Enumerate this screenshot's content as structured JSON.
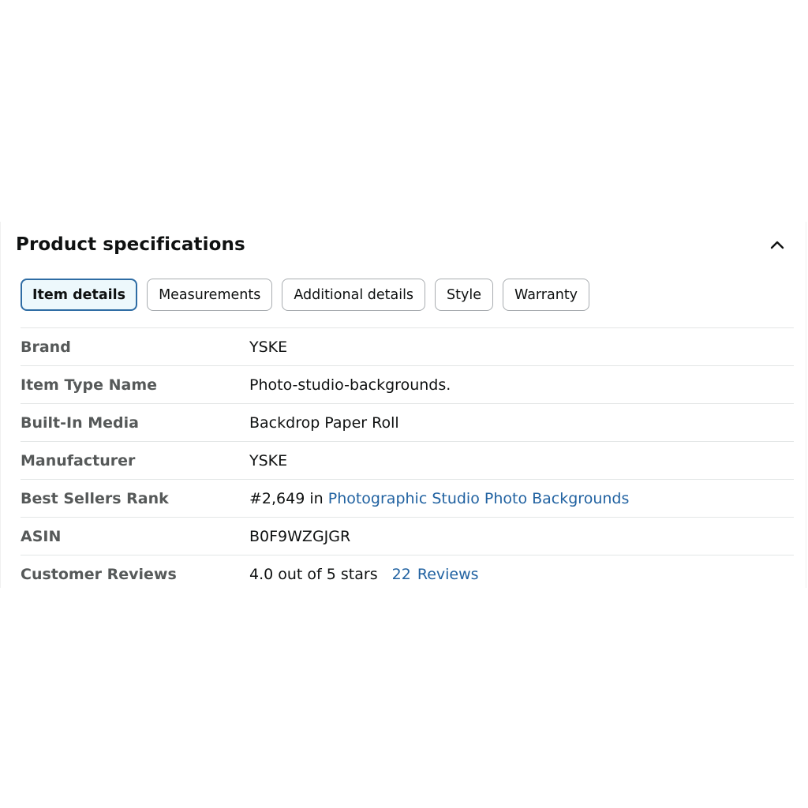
{
  "section": {
    "title": "Product specifications",
    "collapse_icon": "chevron-up-icon"
  },
  "tabs": [
    {
      "label": "Item details",
      "active": true
    },
    {
      "label": "Measurements",
      "active": false
    },
    {
      "label": "Additional details",
      "active": false
    },
    {
      "label": "Style",
      "active": false
    },
    {
      "label": "Warranty",
      "active": false
    }
  ],
  "specs": {
    "brand": {
      "label": "Brand",
      "value": "YSKE"
    },
    "item_type": {
      "label": "Item Type Name",
      "value": "Photo-studio-backgrounds."
    },
    "built_in_media": {
      "label": "Built-In Media",
      "value": "Backdrop Paper Roll"
    },
    "manufacturer": {
      "label": "Manufacturer",
      "value": "YSKE"
    },
    "rank": {
      "label": "Best Sellers Rank",
      "prefix": "#2,649 in",
      "category_link": "Photographic Studio Photo Backgrounds"
    },
    "asin": {
      "label": "ASIN",
      "value": "B0F9WZGJGR"
    },
    "reviews": {
      "label": "Customer Reviews",
      "rating_text": "4.0 out of 5 stars",
      "count": "22",
      "count_label": "Reviews"
    }
  },
  "colors": {
    "accent_border": "#2e6ca4",
    "active_tab_bg": "#edf8fc",
    "link": "#2162a1",
    "label_text": "#565959"
  }
}
